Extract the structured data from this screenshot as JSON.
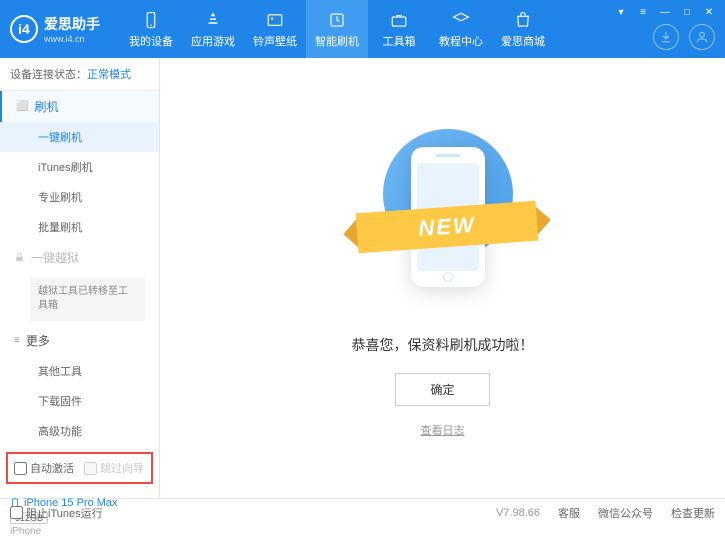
{
  "header": {
    "logo_title": "爱思助手",
    "logo_sub": "www.i4.cn",
    "nav": [
      {
        "label": "我的设备"
      },
      {
        "label": "应用游戏"
      },
      {
        "label": "铃声壁纸"
      },
      {
        "label": "智能刷机"
      },
      {
        "label": "工具箱"
      },
      {
        "label": "教程中心"
      },
      {
        "label": "爱思商城"
      }
    ]
  },
  "sidebar": {
    "status_label": "设备连接状态：",
    "status_value": "正常模式",
    "flash_head": "刷机",
    "flash_items": [
      "一键刷机",
      "iTunes刷机",
      "专业刷机",
      "批量刷机"
    ],
    "jailbreak_head": "一键越狱",
    "jailbreak_note": "越狱工具已转移至工具箱",
    "more_head": "更多",
    "more_items": [
      "其他工具",
      "下载固件",
      "高级功能"
    ],
    "checks": {
      "auto_activate": "自动激活",
      "skip_guide": "跳过向导"
    },
    "device": {
      "name": "iPhone 15 Pro Max",
      "storage": "512GB",
      "type": "iPhone"
    }
  },
  "main": {
    "banner": "NEW",
    "success": "恭喜您，保资料刷机成功啦！",
    "ok": "确定",
    "log": "查看日志"
  },
  "footer": {
    "block_itunes": "阻止iTunes运行",
    "version": "V7.98.66",
    "links": [
      "客服",
      "微信公众号",
      "检查更新"
    ]
  }
}
